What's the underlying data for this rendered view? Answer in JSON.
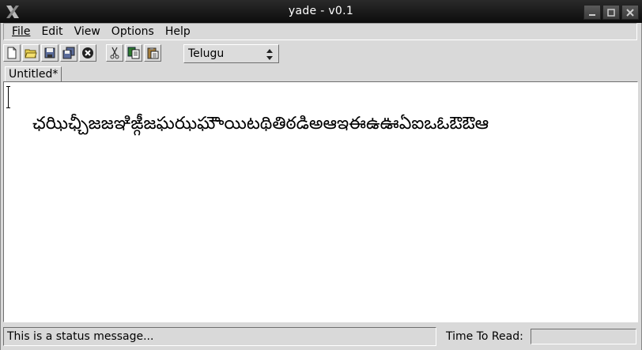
{
  "window": {
    "title": "yade - v0.1"
  },
  "menubar": {
    "items": [
      {
        "label": "File"
      },
      {
        "label": "Edit"
      },
      {
        "label": "View"
      },
      {
        "label": "Options"
      },
      {
        "label": "Help"
      }
    ]
  },
  "toolbar": {
    "buttons": [
      {
        "icon": "new-file-icon"
      },
      {
        "icon": "open-folder-icon"
      },
      {
        "icon": "save-icon"
      },
      {
        "icon": "save-all-icon"
      },
      {
        "icon": "close-icon"
      },
      {
        "icon": "cut-icon"
      },
      {
        "icon": "copy-icon"
      },
      {
        "icon": "paste-icon"
      }
    ],
    "language_select": {
      "value": "Telugu"
    }
  },
  "tabs": [
    {
      "label": "Untitled*"
    }
  ],
  "editor": {
    "text": "ఛఝిఛ్చీజజఞిఙ్గీజఘఝఘౌాయిటథితిఠడిఅఆఇఈఉఊఏఐఒఓఔఔఆ"
  },
  "statusbar": {
    "message": "This is a status message...",
    "time_to_read_label": "Time To Read:",
    "time_to_read_value": ""
  }
}
